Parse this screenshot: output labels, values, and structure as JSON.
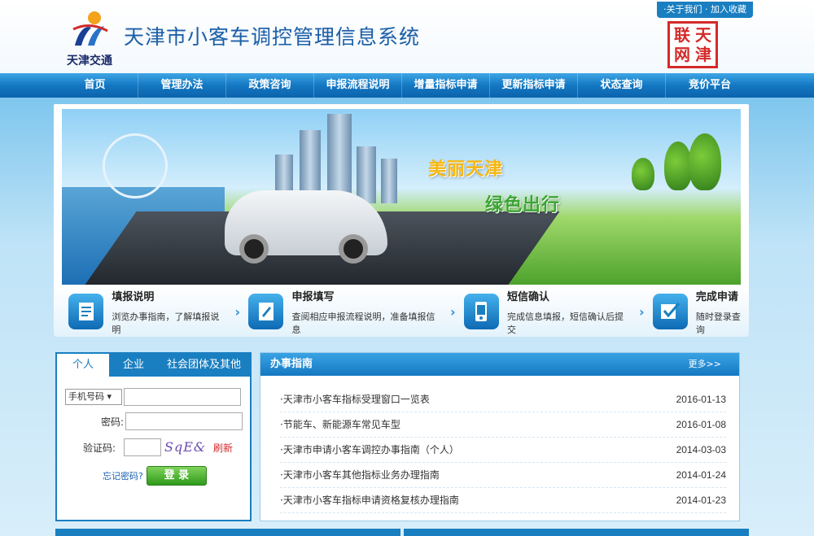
{
  "header": {
    "top_links": "·关于我们 · 加入收藏",
    "logo_text": "天津交通",
    "site_title": "天津市小客车调控管理信息系统",
    "seal_chars": [
      "天",
      "津",
      "网",
      "联"
    ]
  },
  "nav": {
    "items": [
      {
        "label": "首页"
      },
      {
        "label": "管理办法"
      },
      {
        "label": "政策咨询"
      },
      {
        "label": "申报流程说明"
      },
      {
        "label": "增量指标申请"
      },
      {
        "label": "更新指标申请"
      },
      {
        "label": "状态查询"
      },
      {
        "label": "竞价平台"
      }
    ]
  },
  "banner": {
    "slogan1": "美丽天津",
    "slogan2": "绿色出行"
  },
  "steps": [
    {
      "title": "填报说明",
      "desc": "浏览办事指南，了解填报说明",
      "icon": "document-icon"
    },
    {
      "title": "申报填写",
      "desc": "查阅相应申报流程说明，准备填报信息",
      "icon": "form-icon"
    },
    {
      "title": "短信确认",
      "desc": "完成信息填报，短信确认后提交",
      "icon": "phone-icon"
    },
    {
      "title": "完成申请",
      "desc": "随时登录查询",
      "icon": "check-icon"
    }
  ],
  "login": {
    "tabs": [
      "个人",
      "企业",
      "社会团体及其他"
    ],
    "id_type": "手机号码",
    "password_label": "密码:",
    "captcha_label": "验证码:",
    "captcha_text": "SqE&",
    "refresh": "刷新",
    "forgot": "忘记密码?",
    "submit": "登 录"
  },
  "guide": {
    "title": "办事指南",
    "more": "更多>>",
    "items": [
      {
        "title": "·天津市小客车指标受理窗口一览表",
        "date": "2016-01-13"
      },
      {
        "title": "·节能车、新能源车常见车型",
        "date": "2016-01-08"
      },
      {
        "title": "·天津市申请小客车调控办事指南（个人）",
        "date": "2014-03-03"
      },
      {
        "title": "·天津市小客车其他指标业务办理指南",
        "date": "2014-01-24"
      },
      {
        "title": "·天津市小客车指标申请资格复核办理指南",
        "date": "2014-01-23"
      }
    ]
  },
  "colors": {
    "primary": "#1a7fc1",
    "title": "#1c5fa8",
    "seal": "#d42a2a",
    "button": "#2f9a1c"
  }
}
